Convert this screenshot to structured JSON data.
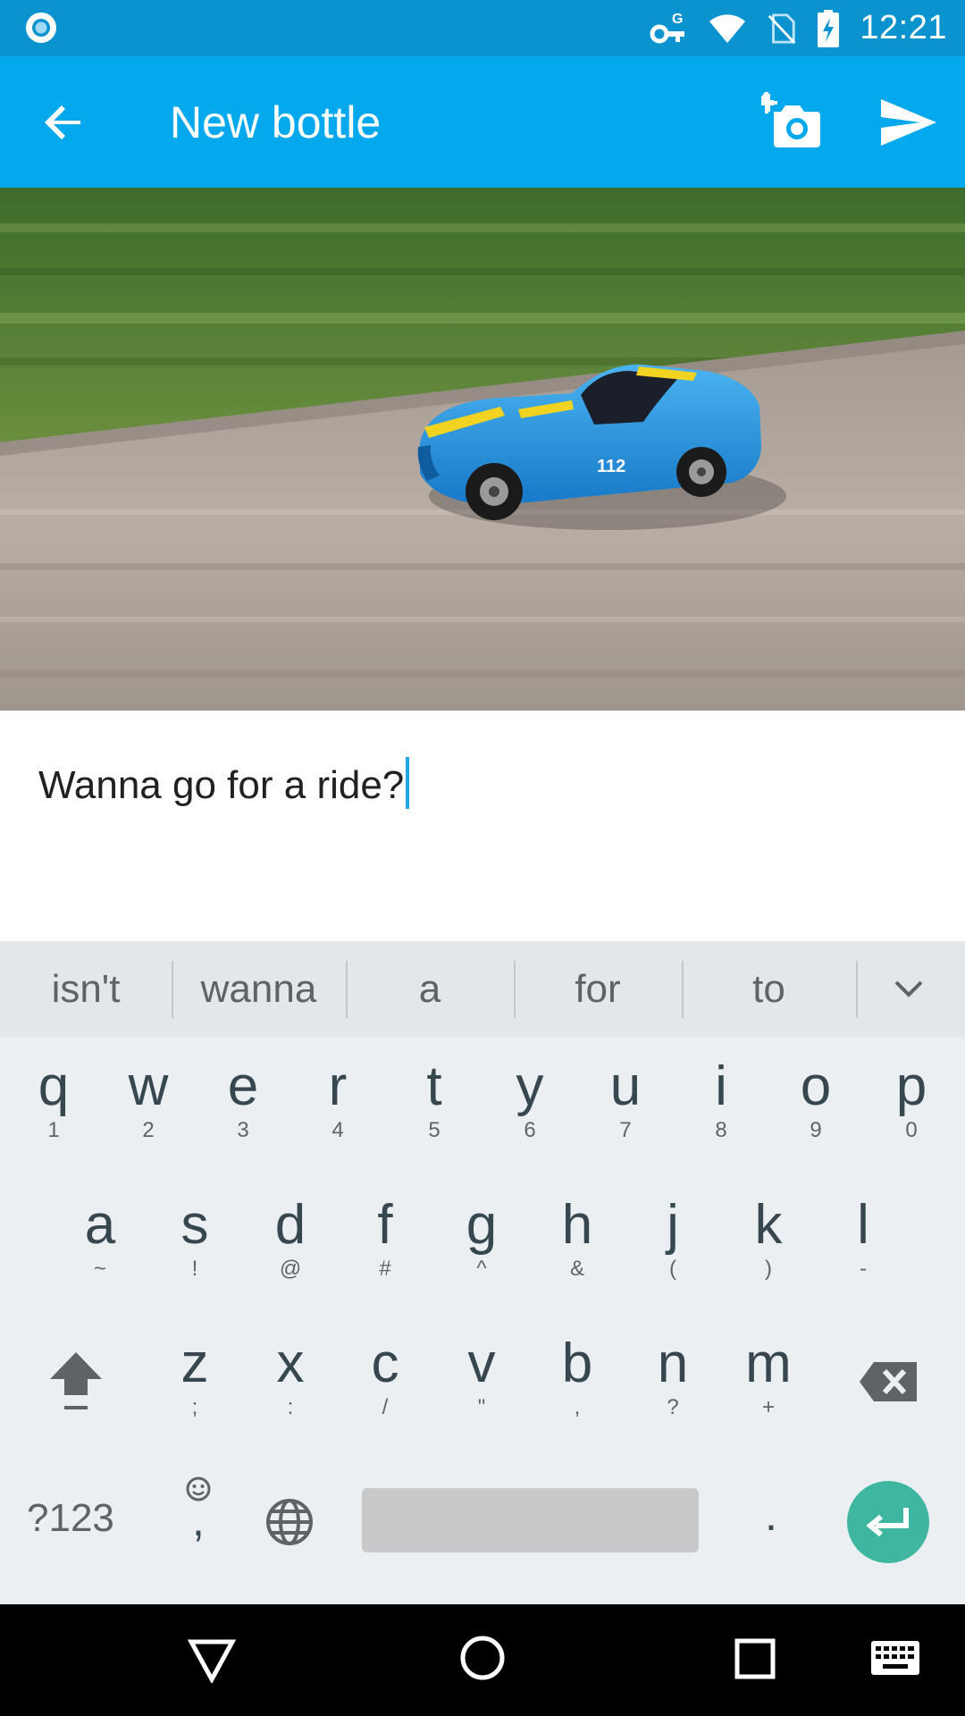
{
  "status_bar": {
    "time": "12:21",
    "icons": [
      "chrome-notification-icon",
      "vpn-key-icon",
      "wifi-icon",
      "no-sim-icon",
      "battery-charging-icon"
    ]
  },
  "app_bar": {
    "title": "New bottle",
    "back_icon": "arrow-back-icon",
    "camera_icon": "add-a-photo-icon",
    "send_icon": "send-icon"
  },
  "photo": {
    "subject": "blue toy race car",
    "car_number": "112"
  },
  "message": {
    "text": "Wanna go for a ride?"
  },
  "keyboard": {
    "suggestions": [
      "isn't",
      "wanna",
      "a",
      "for",
      "to"
    ],
    "row1": [
      {
        "key": "q",
        "sub": "1"
      },
      {
        "key": "w",
        "sub": "2"
      },
      {
        "key": "e",
        "sub": "3"
      },
      {
        "key": "r",
        "sub": "4"
      },
      {
        "key": "t",
        "sub": "5"
      },
      {
        "key": "y",
        "sub": "6"
      },
      {
        "key": "u",
        "sub": "7"
      },
      {
        "key": "i",
        "sub": "8"
      },
      {
        "key": "o",
        "sub": "9"
      },
      {
        "key": "p",
        "sub": "0"
      }
    ],
    "row2": [
      {
        "key": "a",
        "sub": "~"
      },
      {
        "key": "s",
        "sub": "!"
      },
      {
        "key": "d",
        "sub": "@"
      },
      {
        "key": "f",
        "sub": "#"
      },
      {
        "key": "g",
        "sub": "^"
      },
      {
        "key": "h",
        "sub": "&"
      },
      {
        "key": "j",
        "sub": "("
      },
      {
        "key": "k",
        "sub": ")"
      },
      {
        "key": "l",
        "sub": "-"
      }
    ],
    "row3": [
      {
        "key": "z",
        "sub": ";"
      },
      {
        "key": "x",
        "sub": ":"
      },
      {
        "key": "c",
        "sub": "/"
      },
      {
        "key": "v",
        "sub": "\""
      },
      {
        "key": "b",
        "sub": ","
      },
      {
        "key": "n",
        "sub": "?"
      },
      {
        "key": "m",
        "sub": "+"
      }
    ],
    "symbols_label": "?123",
    "comma_label": ",",
    "period_label": ".",
    "accent_color": "#3fb7a0"
  },
  "nav_bar": {
    "icons": [
      "back-triangle-icon",
      "home-circle-icon",
      "recents-square-icon",
      "keyboard-icon"
    ]
  },
  "colors": {
    "status_bar": "#0a93cf",
    "app_bar": "#03a9ec",
    "caret": "#1ea7e6"
  }
}
